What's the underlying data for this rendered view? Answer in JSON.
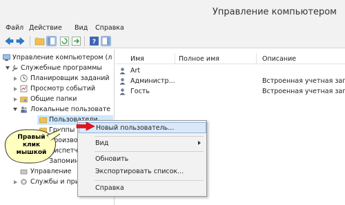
{
  "window": {
    "title": "Управление компьютером"
  },
  "menu": [
    "Файл",
    "Действие",
    "Вид",
    "Справка"
  ],
  "toolbar": {
    "icons": [
      "back-icon",
      "forward-icon",
      "up-folder-icon",
      "show-hide-tree-icon",
      "refresh-icon",
      "export-icon",
      "help-icon",
      "show-hide-action-pane-icon"
    ]
  },
  "tree": {
    "items": [
      {
        "label": "Управление компьютером (л",
        "icon": "computer-management-icon"
      },
      {
        "label": "Служебные программы",
        "icon": "tools-icon"
      },
      {
        "label": "Планировщик заданий",
        "icon": "clock-icon"
      },
      {
        "label": "Просмотр событий",
        "icon": "event-viewer-icon"
      },
      {
        "label": "Общие папки",
        "icon": "shared-folder-icon"
      },
      {
        "label": "Локальные пользовате",
        "icon": "users-icon"
      },
      {
        "label": "Пользователи",
        "icon": "folder-icon"
      },
      {
        "label": "Группы",
        "icon": "folder-icon"
      },
      {
        "label": "Производ",
        "icon": "performance-icon"
      },
      {
        "label": "Диспетчер",
        "icon": "device-manager-icon"
      },
      {
        "label": "Запоминающ",
        "icon": "storage-icon"
      },
      {
        "label": "Управление",
        "icon": "disk-icon"
      },
      {
        "label": "Службы и при",
        "icon": "services-icon"
      }
    ]
  },
  "list": {
    "columns": [
      "Имя",
      "Полное имя",
      "Описание"
    ],
    "rows": [
      {
        "name": "Art",
        "full_name": "",
        "description": ""
      },
      {
        "name": "Администр...",
        "full_name": "",
        "description": "Встроенная учетная запис"
      },
      {
        "name": "Гость",
        "full_name": "",
        "description": "Встроенная учетная запис"
      }
    ]
  },
  "context_menu": {
    "items": [
      "Новый пользователь...",
      "Вид",
      "Обновить",
      "Экспортировать список...",
      "Справка"
    ]
  },
  "callout": {
    "text_lines": [
      "Правый",
      "клик",
      "мышкой"
    ]
  }
}
